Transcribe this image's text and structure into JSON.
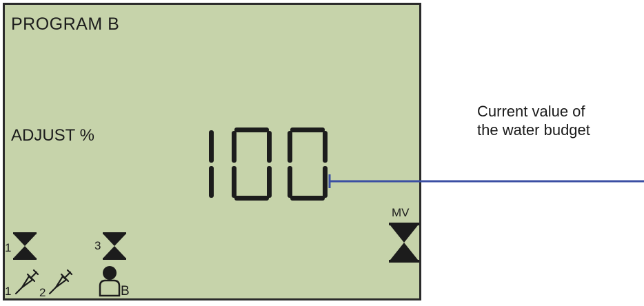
{
  "lcd": {
    "program_text": "PROGRAM  B",
    "adjust_text": "ADJUST %",
    "value": "100",
    "mv_label": "MV",
    "valve_numbers": [
      "1",
      "3"
    ],
    "sensor_numbers": [
      "1",
      "2"
    ],
    "sensor_letter": "B"
  },
  "callout": {
    "line1": "Current value of",
    "line2": "the water budget",
    "color": "#3b4fa3"
  },
  "colors": {
    "lcd_background": "#c6d3aa",
    "segment": "#1c1c1c"
  },
  "icons": [
    "valve-hourglass-icon",
    "sensor-probe-icon",
    "person-icon"
  ]
}
